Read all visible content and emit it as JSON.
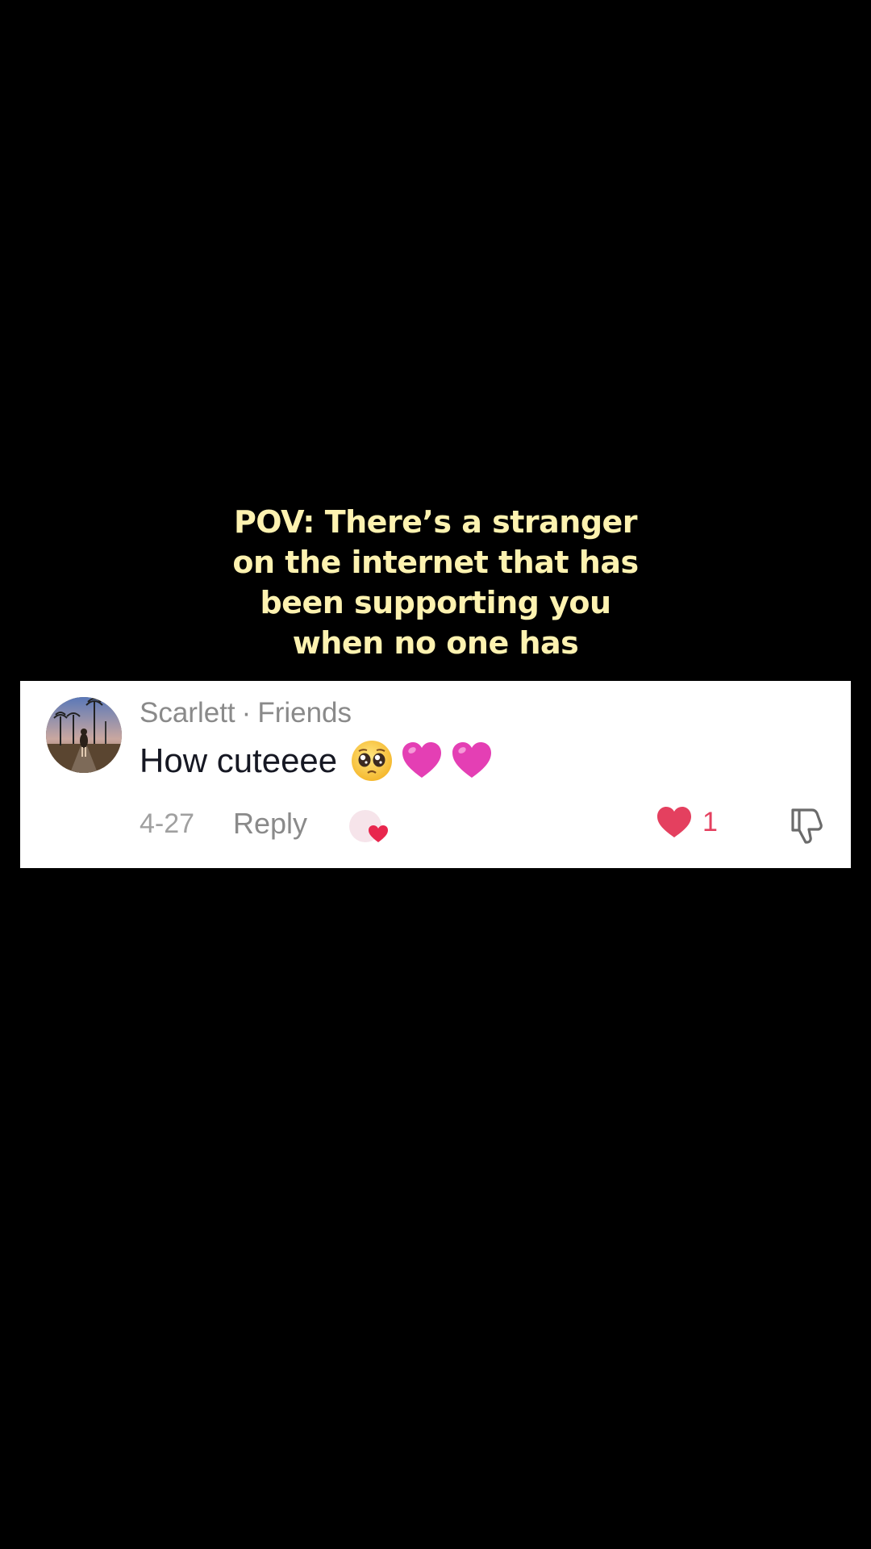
{
  "caption": {
    "lines": [
      "POV: There’s a stranger",
      "on the internet that has",
      "been supporting you",
      "when no one has"
    ]
  },
  "comment": {
    "author": "Scarlett",
    "separator": "·",
    "relation": "Friends",
    "text": "How cuteeee",
    "emojis": [
      "pleading-face-emoji",
      "pink-heart-emoji",
      "pink-heart-emoji"
    ],
    "date": "4-27",
    "reply_label": "Reply",
    "like_count": "1",
    "colors": {
      "like": "#e4405f",
      "emoji_heart": "#e43fb4",
      "caption": "#fdf2b0"
    }
  }
}
